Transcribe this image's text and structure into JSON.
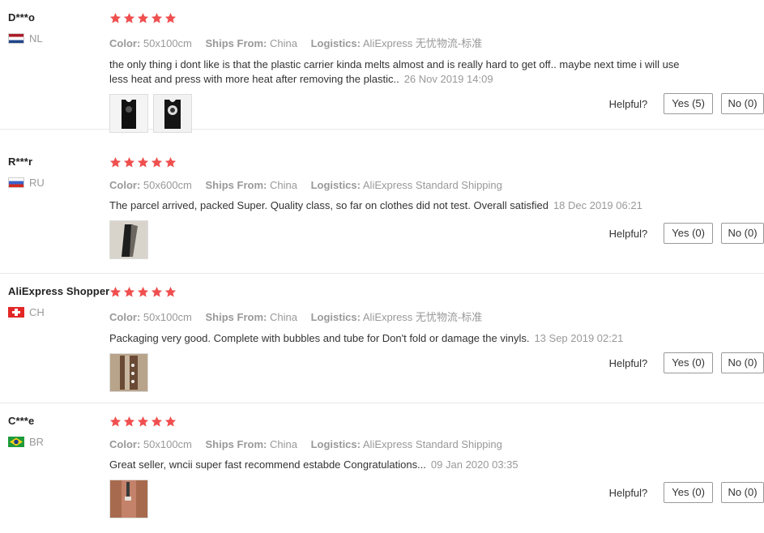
{
  "colors": {
    "star": "#f04f4f",
    "muted": "#999999",
    "text": "#333333",
    "divider": "#e8e8e8"
  },
  "reviews": [
    {
      "user": "D***o",
      "country_code": "NL",
      "flag_icon": "flag-netherlands-icon",
      "stars": 5,
      "color_label": "Color:",
      "color_value": "50x100cm",
      "ships_label": "Ships From:",
      "ships_value": "China",
      "logistics_label": "Logistics:",
      "logistics_value": "AliExpress 无忧物流-标准",
      "text": "the only thing i dont like is that the plastic carrier kinda melts almost and is really hard to get off.. maybe next time i will use less heat and press with more heat after removing the plastic..",
      "date": "26 Nov 2019 14:09",
      "photos": [
        "black-tank-top-photo",
        "black-tank-top-print-photo"
      ],
      "helpful_label": "Helpful?",
      "yes_label": "Yes (5)",
      "no_label": "No (0)"
    },
    {
      "user": "R***r",
      "country_code": "RU",
      "flag_icon": "flag-russia-icon",
      "stars": 5,
      "color_label": "Color:",
      "color_value": "50x600cm",
      "ships_label": "Ships From:",
      "ships_value": "China",
      "logistics_label": "Logistics:",
      "logistics_value": "AliExpress Standard Shipping",
      "text": "The parcel arrived, packed Super. Quality class, so far on clothes did not test. Overall satisfied",
      "date": "18 Dec 2019 06:21",
      "photos": [
        "rolled-vinyl-photo"
      ],
      "helpful_label": "Helpful?",
      "yes_label": "Yes (0)",
      "no_label": "No (0)"
    },
    {
      "user": "AliExpress Shopper",
      "country_code": "CH",
      "flag_icon": "flag-switzerland-icon",
      "stars": 5,
      "color_label": "Color:",
      "color_value": "50x100cm",
      "ships_label": "Ships From:",
      "ships_value": "China",
      "logistics_label": "Logistics:",
      "logistics_value": "AliExpress 无忧物流-标准",
      "text": "Packaging very good. Complete with bubbles and tube for Don't fold or damage the vinyls.",
      "date": "13 Sep 2019 02:21",
      "photos": [
        "package-tube-photo"
      ],
      "helpful_label": "Helpful?",
      "yes_label": "Yes (0)",
      "no_label": "No (0)"
    },
    {
      "user": "C***e",
      "country_code": "BR",
      "flag_icon": "flag-brazil-icon",
      "stars": 5,
      "color_label": "Color:",
      "color_value": "50x100cm",
      "ships_label": "Ships From:",
      "ships_value": "China",
      "logistics_label": "Logistics:",
      "logistics_value": "AliExpress Standard Shipping",
      "text": "Great seller, wncii super fast recommend estabde Congratulations...",
      "date": "09 Jan 2020 03:35",
      "photos": [
        "vinyl-roll-on-wood-photo"
      ],
      "helpful_label": "Helpful?",
      "yes_label": "Yes (0)",
      "no_label": "No (0)"
    }
  ]
}
